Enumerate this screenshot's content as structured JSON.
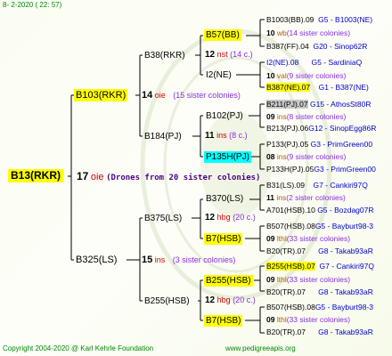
{
  "date": "8-  2-2020 ( 22: 57)",
  "footer": {
    "copyright": "Copyright 2004-2020 @ Karl Kehrle Foundation",
    "site": "www.pedigreeapis.org"
  },
  "root": {
    "name": "B13(RKR)",
    "num": "17",
    "code": "oie",
    "note": "(Drones from 20 sister colonies)"
  },
  "g1": [
    {
      "name": "B103(RKR)",
      "num": "14",
      "code": "oie",
      "note": "(15 sister colonies)"
    },
    {
      "name": "B325(LS)",
      "num": "15",
      "code": "ins",
      "note": "(3 sister colonies)"
    }
  ],
  "g2": [
    {
      "name": "B38(RKR)",
      "num": "12",
      "code": "nst",
      "note": "(14 c.)"
    },
    {
      "name": "B184(PJ)",
      "num": "11",
      "code": "ins",
      "note": "(8 c.)"
    },
    {
      "name": "B375(LS)",
      "num": "12",
      "code": "hbg",
      "note": "(20 c.)"
    },
    {
      "name": "B255(HSB)",
      "num": "12",
      "code": "hbg",
      "note": "(20 c.)"
    }
  ],
  "g3": [
    {
      "name": "B57(BB)"
    },
    {
      "name": "I2(NE)"
    },
    {
      "name": "B102(PJ)"
    },
    {
      "name": "P135H(PJ)"
    },
    {
      "name": "B370(LS)"
    },
    {
      "name": "B7(HSB)"
    },
    {
      "name": "B255(HSB)"
    },
    {
      "name": "B7(HSB)"
    }
  ],
  "g3_stats": [
    {
      "num": "12",
      "code": "nst",
      "note": "(14 c.)"
    },
    {
      "num": "11",
      "code": "ins",
      "note": "(8 c.)"
    },
    {
      "num": "12",
      "code": "hbg",
      "note": "(20 c.)"
    },
    {
      "num": "12",
      "code": "hbg",
      "note": "(20 c.)"
    }
  ],
  "leaves": [
    {
      "name": "B1003(BB).09",
      "extra": "G5 - B1003(NE)"
    },
    {
      "num": "10",
      "code": "wb",
      "note": "(14 sister colonies)"
    },
    {
      "name": "B387(FF).04",
      "extra": "G20 - Sinop62R"
    },
    {
      "name": "I2(NE).08",
      "extra": "G5 - SardiniaQ"
    },
    {
      "num": "10",
      "code": "val",
      "note": "(9 sister colonies)"
    },
    {
      "name": "B387(NE).07",
      "extra": "G1 - B387(NE)"
    },
    {
      "name": "B211(PJ).07",
      "extra": "G15 - AthosSt80R"
    },
    {
      "num": "09",
      "code": "ins",
      "note": "(8 sister colonies)"
    },
    {
      "name": "B213(PJ).06",
      "extra": "G12 - SinopEgg86R"
    },
    {
      "name": "P133(PJ).05",
      "extra": "G3 - PrimGreen00"
    },
    {
      "num": "08",
      "code": "ins",
      "note": "(9 sister colonies)"
    },
    {
      "name": "P133H(PJ).05",
      "extra": "G3 - PrimGreen00"
    },
    {
      "name": "B31(LS).09",
      "extra": "G7 - Cankiri97Q"
    },
    {
      "num": "11",
      "code": "ins",
      "note": "(2 sister colonies)"
    },
    {
      "name": "A701(HSB).10",
      "extra": "G5 - Bozdag07R"
    },
    {
      "name": "B507(HSB).08",
      "extra": "G5 - Bayburt98-3"
    },
    {
      "num": "09",
      "code": "lthl",
      "note": "(33 sister colonies)"
    },
    {
      "name": "B20(TR).07",
      "extra": "G8 - Takab93aR"
    },
    {
      "name": "B255(HSB).07",
      "extra": "G7 - Cankiri97Q"
    },
    {
      "num": "09",
      "code": "lthl",
      "note": "(33 sister colonies)"
    },
    {
      "name": "B20(TR).07",
      "extra": "G8 - Takab93aR"
    },
    {
      "name": "B507(HSB).08",
      "extra": "G5 - Bayburt98-3"
    },
    {
      "num": "09",
      "code": "lthl",
      "note": "(33 sister colonies)"
    },
    {
      "name": "B20(TR).07",
      "extra": "G8 - Takab93aR"
    }
  ]
}
